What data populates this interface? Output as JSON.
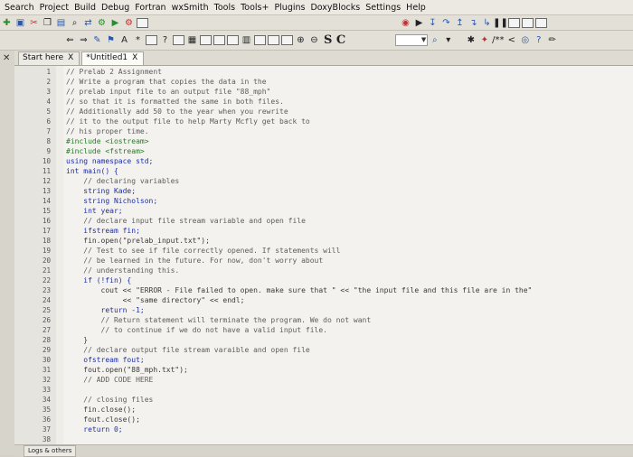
{
  "menu": [
    "Search",
    "Project",
    "Build",
    "Debug",
    "Fortran",
    "wxSmith",
    "Tools",
    "Tools+",
    "Plugins",
    "DoxyBlocks",
    "Settings",
    "Help"
  ],
  "toolbar2": {
    "scope_text": "",
    "sc_label": "S C"
  },
  "icons": [
    "bookmark-icon",
    "undo-icon",
    "redo-icon",
    "play-icon",
    "pause-icon",
    "stop-icon",
    "search-icon",
    "zoom-in-icon",
    "zoom-out-icon"
  ],
  "tabs": [
    {
      "label": "Start here",
      "close": "X"
    },
    {
      "label": "*Untitled1",
      "close": "X"
    }
  ],
  "colors": {
    "keyword": "#1c2fa8",
    "preprocessor": "#2b7a2b",
    "string": "#2b6db0",
    "comment": "#5d5d5d"
  },
  "code": [
    {
      "n": "1",
      "t": "// Prelab 2 Assignment"
    },
    {
      "n": "2",
      "t": "// Write a program that copies the data in the"
    },
    {
      "n": "3",
      "t": "// prelab input file to an output file \"88_mph\""
    },
    {
      "n": "4",
      "t": "// so that it is formatted the same in both files."
    },
    {
      "n": "5",
      "t": "// Additionally add 50 to the year when you rewrite"
    },
    {
      "n": "6",
      "t": "// it to the output file to help Marty Mcfly get back to"
    },
    {
      "n": "7",
      "t": "// his proper time."
    },
    {
      "n": "8",
      "t": "#include <iostream>"
    },
    {
      "n": "9",
      "t": "#include <fstream>"
    },
    {
      "n": "10",
      "t": "using namespace std;"
    },
    {
      "n": "11",
      "t": "int main() {"
    },
    {
      "n": "12",
      "t": "    // declaring variables"
    },
    {
      "n": "13",
      "t": "    string Kade;"
    },
    {
      "n": "14",
      "t": "    string Nicholson;"
    },
    {
      "n": "15",
      "t": "    int year;"
    },
    {
      "n": "16",
      "t": "    // declare input file stream variable and open file"
    },
    {
      "n": "17",
      "t": "    ifstream fin;"
    },
    {
      "n": "18",
      "t": "    fin.open(\"prelab_input.txt\");"
    },
    {
      "n": "19",
      "t": "    // Test to see if file correctly opened. If statements will"
    },
    {
      "n": "20",
      "t": "    // be learned in the future. For now, don't worry about"
    },
    {
      "n": "21",
      "t": "    // understanding this."
    },
    {
      "n": "22",
      "t": "    if (!fin) {"
    },
    {
      "n": "23",
      "t": "        cout << \"ERROR - File failed to open. make sure that \" << \"the input file and this file are in the\""
    },
    {
      "n": "24",
      "t": "             << \"same directory\" << endl;"
    },
    {
      "n": "25",
      "t": "        return -1;"
    },
    {
      "n": "26",
      "t": "        // Return statement will terminate the program. We do not want"
    },
    {
      "n": "27",
      "t": "        // to continue if we do not have a valid input file."
    },
    {
      "n": "28",
      "t": "    }"
    },
    {
      "n": "29",
      "t": "    // declare output file stream varaible and open file"
    },
    {
      "n": "30",
      "t": "    ofstream fout;"
    },
    {
      "n": "31",
      "t": "    fout.open(\"88_mph.txt\");"
    },
    {
      "n": "32",
      "t": "    // ADD CODE HERE"
    },
    {
      "n": "33",
      "t": ""
    },
    {
      "n": "34",
      "t": "    // closing files"
    },
    {
      "n": "35",
      "t": "    fin.close();"
    },
    {
      "n": "36",
      "t": "    fout.close();"
    },
    {
      "n": "37",
      "t": "    return 0;"
    },
    {
      "n": "38",
      "t": ""
    }
  ],
  "bottom_tab": "Logs & others"
}
